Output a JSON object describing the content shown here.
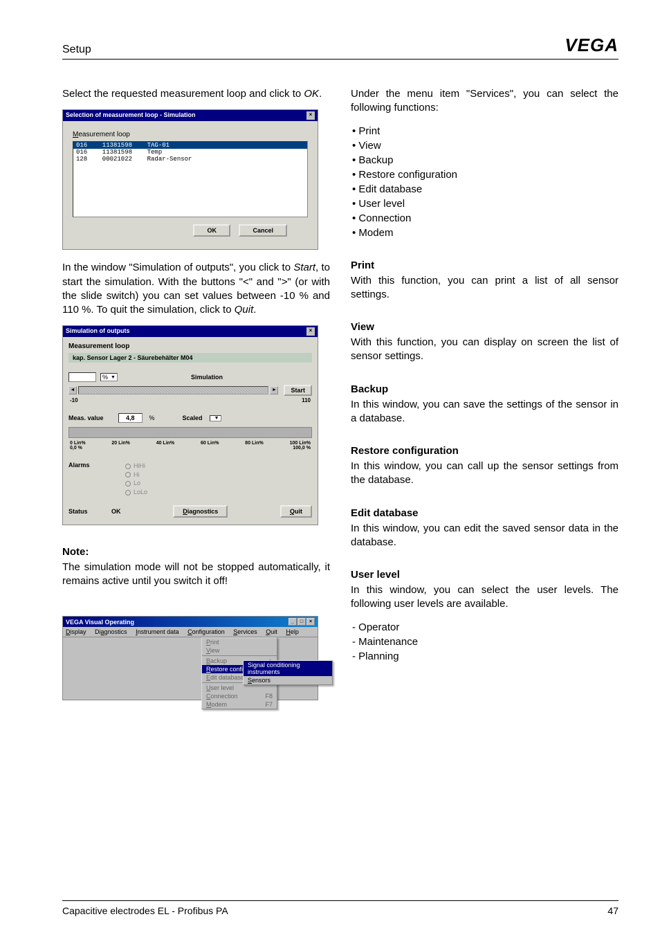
{
  "header": {
    "title": "Setup",
    "logo": "VEGA"
  },
  "left": {
    "p1a": "Select the requested measurement loop and click to ",
    "p1b": "OK",
    "p1c": ".",
    "s1": {
      "title": "Selection of measurement loop - Simulation",
      "label": "Measurement loop",
      "rows": [
        "016    11381598    TAG-01",
        "016    11381598    Temp",
        "128    00021022    Radar-Sensor"
      ],
      "ok": "OK",
      "cancel": "Cancel"
    },
    "p2a": "In the window \"Simulation of outputs\", you click to ",
    "p2b": "Start",
    "p2c": ", to start the simulation. With the buttons \"",
    "p2d": "<",
    "p2e": "\" and \"",
    "p2f": ">",
    "p2g": "\" (or with the slide switch) you can set values between -10 % and 110 %. To quit the simulation, click to ",
    "p2h": "Quit",
    "p2i": ".",
    "s2": {
      "title": "Simulation of outputs",
      "loop_lbl": "Measurement loop",
      "loop_val": "kap. Sensor       Lager 2  -  Säurebehälter M04",
      "unit": "%",
      "sim_lbl": "Simulation",
      "start": "Start",
      "range_lo": "-10",
      "range_hi": "110",
      "meas_lbl": "Meas. value",
      "meas_val": "4,8",
      "meas_unit": "%",
      "scaled_lbl": "Scaled",
      "ticks": [
        "0 Lin%\n0,0 %",
        "20 Lin%",
        "40 Lin%",
        "60 Lin%",
        "80 Lin%",
        "100 Lin%\n100,0 %"
      ],
      "alarms_lbl": "Alarms",
      "alarms": [
        "HiHi",
        "Hi",
        "Lo",
        "LoLo"
      ],
      "status_lbl": "Status",
      "status_val": "OK",
      "diag": "Diagnostics",
      "quit": "Quit"
    },
    "note_title": "Note:",
    "note_body": "The simulation mode will not be stopped automatically, it remains active until you switch it off!",
    "s3": {
      "title": "VEGA Visual Operating",
      "menubar": [
        "Display",
        "Diagnostics",
        "Instrument data",
        "Configuration",
        "Services",
        "Quit",
        "Help"
      ],
      "menu1": [
        "Print",
        "View",
        "Backup",
        "Restore configuration",
        "Edit database",
        "User level",
        "Connection",
        "Modem"
      ],
      "menu1_sc": {
        "6": "F8",
        "7": "F7"
      },
      "menu1_arrow": {
        "2": ">",
        "3": ">"
      },
      "menu2": [
        "Signal conditioning instruments",
        "Sensors"
      ]
    }
  },
  "right": {
    "intro": "Under the menu item \"Services\", you can select the following functions:",
    "functions": [
      "Print",
      "View",
      "Backup",
      "Restore configuration",
      "Edit database",
      "User level",
      "Connection",
      "Modem"
    ],
    "print_h": "Print",
    "print_b": "With this function, you can print a list of all sensor settings.",
    "view_h": "View",
    "view_b": "With this function, you can display on screen the list of sensor settings.",
    "backup_h": "Backup",
    "backup_b": "In this window, you can save the settings of the sensor in a database.",
    "restore_h": "Restore configuration",
    "restore_b": "In this window, you can call up the sensor settings from the database.",
    "edit_h": "Edit database",
    "edit_b": "In this window, you can edit the saved sensor data in the database.",
    "user_h": "User level",
    "user_b": "In this window, you can select the user levels. The following user levels are available.",
    "user_levels": [
      "Operator",
      "Maintenance",
      "Planning"
    ]
  },
  "footer": {
    "left": "Capacitive electrodes EL - Profibus PA",
    "right": "47"
  }
}
